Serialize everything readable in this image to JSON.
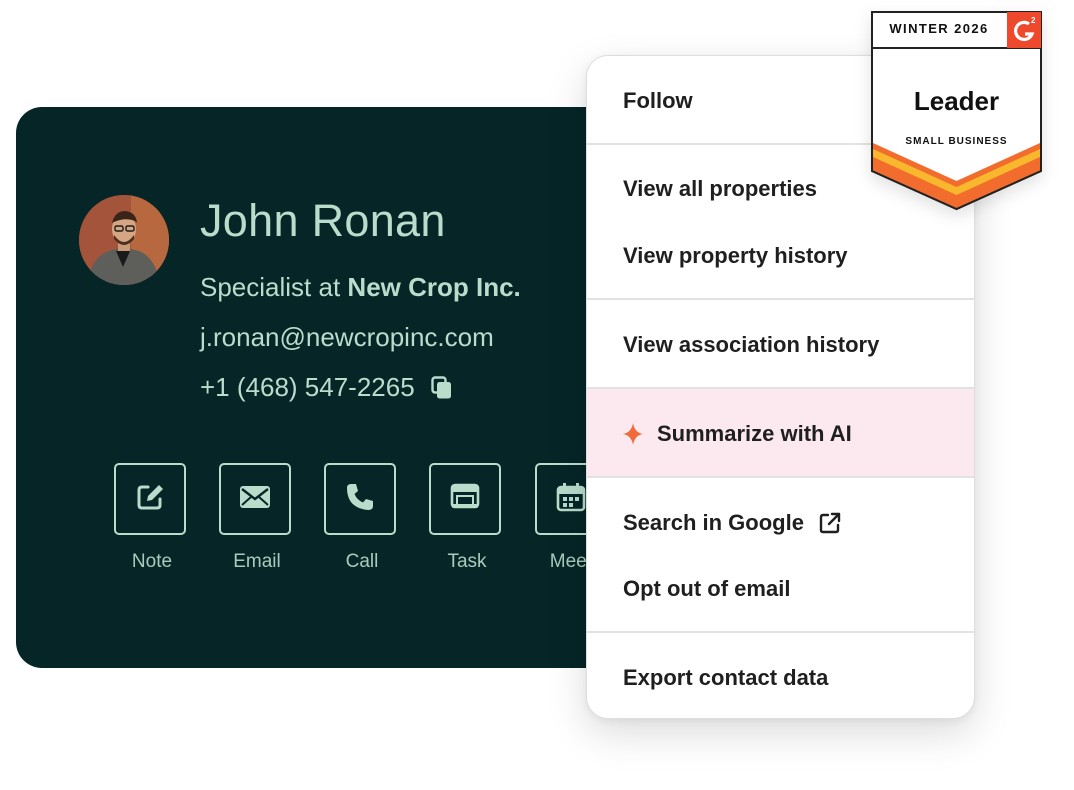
{
  "contact": {
    "name": "John Ronan",
    "title_prefix": "Specialist at",
    "company": "New Crop Inc.",
    "email": "j.ronan@newcropinc.com",
    "phone": "+1 (468) 547-2265"
  },
  "actions": [
    {
      "label": "Note",
      "icon": "note-edit-icon"
    },
    {
      "label": "Email",
      "icon": "envelope-icon"
    },
    {
      "label": "Call",
      "icon": "phone-icon"
    },
    {
      "label": "Task",
      "icon": "task-icon"
    },
    {
      "label": "Meeti",
      "icon": "calendar-icon"
    }
  ],
  "menu": {
    "follow": "Follow",
    "view_all_properties": "View all properties",
    "view_property_history": "View property history",
    "view_association_history": "View association history",
    "summarize_ai": "Summarize with AI",
    "search_google": "Search in Google",
    "opt_out_email": "Opt out of email",
    "export_contact": "Export contact data"
  },
  "badge": {
    "season": "WINTER 2026",
    "logo": "G2",
    "title": "Leader",
    "subtitle": "SMALL BUSINESS"
  },
  "colors": {
    "card_background": "#052527",
    "card_text": "#b9dccb",
    "ai_highlight": "#fbe9ef",
    "sparkle": "#f06a3a",
    "g2_red": "#ef492d",
    "badge_orange": "#f26c2e",
    "badge_yellow": "#f8b72d"
  }
}
